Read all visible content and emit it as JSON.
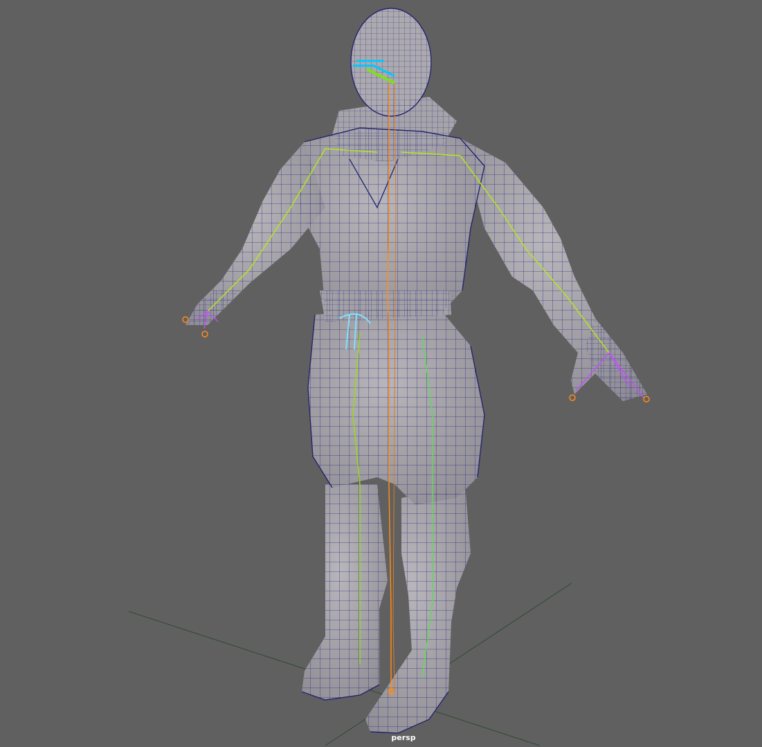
{
  "viewport": {
    "camera_label": "persp",
    "background_color": "#606060"
  },
  "scene": {
    "mesh": {
      "fill_color": "#a9a7ab",
      "shade_color": "#8f8d92",
      "wire_color": "#1f1f7a"
    },
    "skeleton_colors": [
      "#b5e61d",
      "#00c8ff",
      "#ff8c1a",
      "#c050ff"
    ],
    "grid_color": "#2f4a35"
  }
}
